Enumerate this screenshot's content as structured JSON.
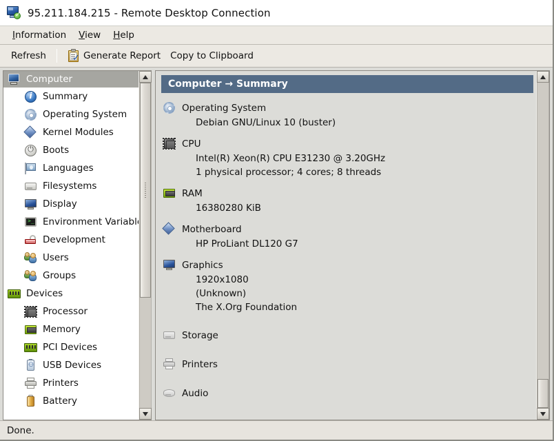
{
  "window": {
    "title": "95.211.184.215 - Remote Desktop Connection",
    "icon": "remote-desktop-icon"
  },
  "menubar": {
    "items": [
      {
        "mnemonic": "I",
        "rest": "nformation"
      },
      {
        "mnemonic": "V",
        "rest": "iew"
      },
      {
        "mnemonic": "H",
        "rest": "elp"
      }
    ]
  },
  "toolbar": {
    "refresh_label": "Refresh",
    "generate_report_label": "Generate Report",
    "copy_to_clipboard_label": "Copy to Clipboard",
    "report_icon": "clipboard-report-icon"
  },
  "sidebar": {
    "header": {
      "label": "Computer",
      "icon": "computer-icon",
      "selected": true
    },
    "items": [
      {
        "label": "Summary",
        "icon": "info-icon",
        "level": "child"
      },
      {
        "label": "Operating System",
        "icon": "gear-icon",
        "level": "child"
      },
      {
        "label": "Kernel Modules",
        "icon": "diamond-icon",
        "level": "child"
      },
      {
        "label": "Boots",
        "icon": "power-icon",
        "level": "child"
      },
      {
        "label": "Languages",
        "icon": "flag-icon",
        "level": "child"
      },
      {
        "label": "Filesystems",
        "icon": "disk-icon",
        "level": "child"
      },
      {
        "label": "Display",
        "icon": "display-icon",
        "level": "child"
      },
      {
        "label": "Environment Variables",
        "icon": "terminal-icon",
        "level": "child"
      },
      {
        "label": "Development",
        "icon": "development-icon",
        "level": "child"
      },
      {
        "label": "Users",
        "icon": "users-icon",
        "level": "child"
      },
      {
        "label": "Groups",
        "icon": "users-icon",
        "level": "child"
      },
      {
        "label": "Devices",
        "icon": "board-icon",
        "level": "group"
      },
      {
        "label": "Processor",
        "icon": "cpu-icon",
        "level": "child"
      },
      {
        "label": "Memory",
        "icon": "memory-icon",
        "level": "child"
      },
      {
        "label": "PCI Devices",
        "icon": "board-icon",
        "level": "child"
      },
      {
        "label": "USB Devices",
        "icon": "usb-icon",
        "level": "child"
      },
      {
        "label": "Printers",
        "icon": "printer-icon",
        "level": "child"
      },
      {
        "label": "Battery",
        "icon": "battery-icon",
        "level": "child"
      }
    ]
  },
  "main": {
    "breadcrumb": "Computer → Summary",
    "sections": [
      {
        "title": "Operating System",
        "icon": "gear-icon",
        "dim": false,
        "values": [
          "Debian GNU/Linux 10 (buster)"
        ]
      },
      {
        "title": "CPU",
        "icon": "cpu-icon",
        "dim": false,
        "values": [
          "Intel(R) Xeon(R) CPU E31230 @ 3.20GHz",
          "1 physical processor; 4 cores; 8 threads"
        ]
      },
      {
        "title": "RAM",
        "icon": "memory-icon",
        "dim": false,
        "values": [
          "16380280 KiB"
        ]
      },
      {
        "title": "Motherboard",
        "icon": "diamond-icon",
        "dim": false,
        "values": [
          "HP ProLiant DL120 G7"
        ]
      },
      {
        "title": "Graphics",
        "icon": "display-icon",
        "dim": false,
        "values": [
          "1920x1080",
          "(Unknown)",
          "The X.Org Foundation"
        ]
      },
      {
        "title": "Storage",
        "icon": "disk-icon",
        "dim": true,
        "values": []
      },
      {
        "title": "Printers",
        "icon": "printer-icon",
        "dim": true,
        "values": []
      },
      {
        "title": "Audio",
        "icon": "audio-icon",
        "dim": true,
        "values": []
      }
    ]
  },
  "statusbar": {
    "message": "Done."
  },
  "colors": {
    "breadcrumb_bg": "#536b86",
    "tree_header_bg": "#a6a6a1",
    "panel_bg": "#dcdcd8",
    "chrome_bg": "#ece9e3"
  }
}
